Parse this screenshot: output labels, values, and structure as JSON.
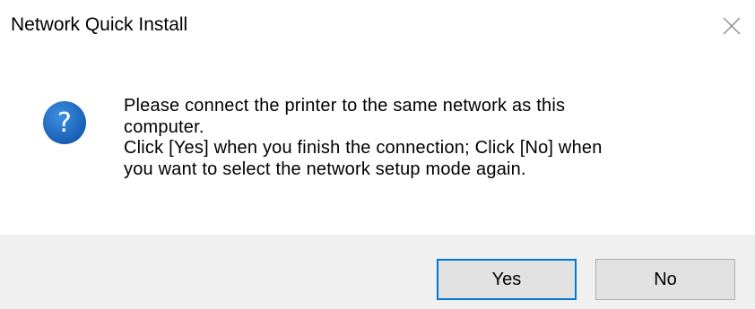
{
  "window": {
    "title": "Network Quick Install",
    "close_icon": "close-icon"
  },
  "message": {
    "icon": "question-icon",
    "icon_color": "#1f6cc4",
    "lines": [
      "Please connect the printer to the same network as this",
      "computer.",
      "Click [Yes] when you finish the connection; Click [No] when",
      "you want to select the network setup mode again."
    ]
  },
  "buttons": {
    "yes_label": "Yes",
    "no_label": "No",
    "default_button": "Yes",
    "accent_color": "#0078d7"
  }
}
